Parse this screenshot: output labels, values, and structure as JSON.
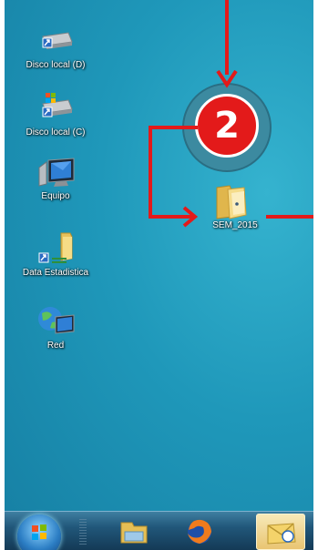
{
  "desktop_icons": [
    {
      "label": "Disco local (D)",
      "icon": "drive-icon"
    },
    {
      "label": "Disco local (C)",
      "icon": "windows-drive-icon"
    },
    {
      "label": "Equipo",
      "icon": "computer-icon"
    },
    {
      "label": "Data Estadistica",
      "icon": "network-folder-icon"
    },
    {
      "label": "Red",
      "icon": "network-icon"
    },
    {
      "label": "SEM_2015",
      "icon": "folder-icon"
    }
  ],
  "callout": {
    "number": "2"
  },
  "taskbar": {
    "items": [
      {
        "icon": "start-orb-icon"
      },
      {
        "icon": "file-explorer-icon"
      },
      {
        "icon": "firefox-icon"
      },
      {
        "icon": "outlook-icon"
      }
    ]
  },
  "colors": {
    "desktop": "#1f98ba",
    "annotation": "#e31a1a"
  }
}
